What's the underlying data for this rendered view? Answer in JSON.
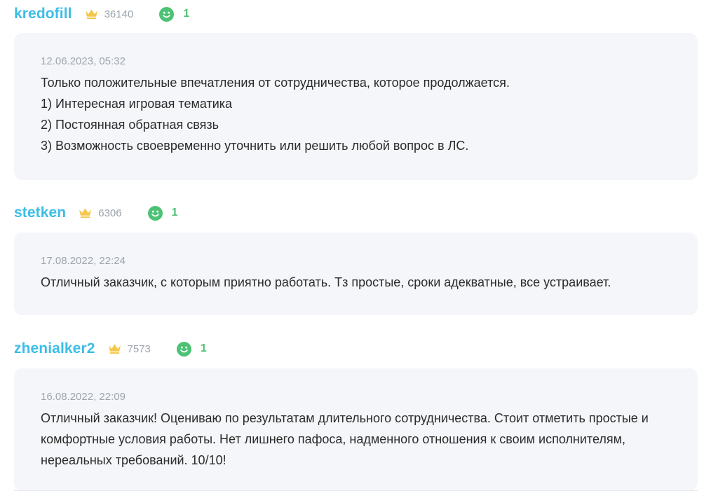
{
  "reviews": [
    {
      "username": "kredofill",
      "rating": "36140",
      "positive_count": "1",
      "date": "12.06.2023, 05:32",
      "lines": [
        "Только положительные впечатления от сотрудничества, которое продолжается.",
        "1) Интересная игровая тематика",
        "2) Постоянная обратная связь",
        "3) Возможность своевременно уточнить или решить любой вопрос в ЛС."
      ]
    },
    {
      "username": "stetken",
      "rating": "6306",
      "positive_count": "1",
      "date": "17.08.2022, 22:24",
      "lines": [
        "Отличный заказчик, с которым приятно работать. Тз простые, сроки адекватные, все устраивает."
      ]
    },
    {
      "username": "zhenialker2",
      "rating": "7573",
      "positive_count": "1",
      "date": "16.08.2022, 22:09",
      "lines": [
        "Отличный заказчик! Оцениваю по результатам длительного сотрудничества. Стоит отметить простые и комфортные условия работы. Нет лишнего пафоса, надменного отношения к своим исполнителям, нереальных требований. 10/10!"
      ]
    }
  ],
  "icons": {
    "rating": "crown-icon",
    "positive": "smile-icon"
  },
  "colors": {
    "username": "#3dbde6",
    "crown": "#f5c84c",
    "positive": "#4cc274",
    "card_bg": "#f4f6f9",
    "meta_text": "#9ea6ae",
    "body_text": "#2b2b2b"
  }
}
